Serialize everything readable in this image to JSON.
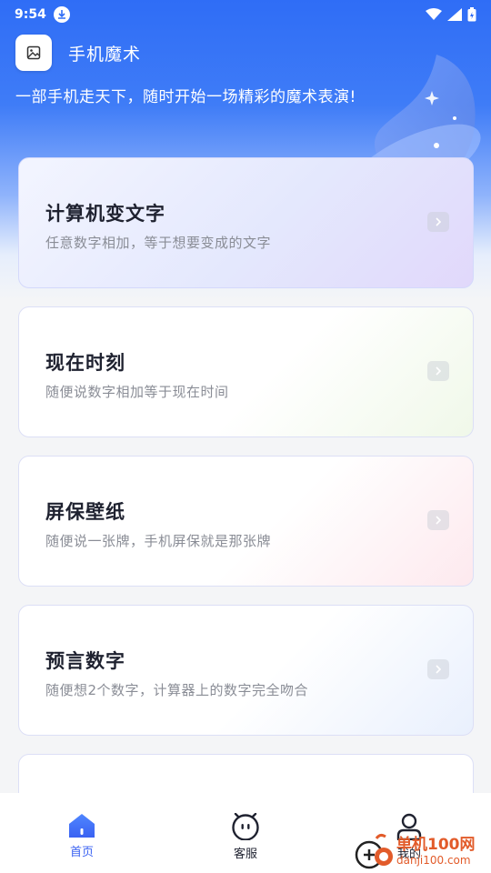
{
  "status": {
    "time": "9:54"
  },
  "app": {
    "title": "手机魔术",
    "tagline": "一部手机走天下，随时开始一场精彩的魔术表演!"
  },
  "cards": [
    {
      "title": "计算机变文字",
      "subtitle": "任意数字相加，等于想要变成的文字"
    },
    {
      "title": "现在时刻",
      "subtitle": "随便说数字相加等于现在时间"
    },
    {
      "title": "屏保壁纸",
      "subtitle": "随便说一张牌，手机屏保就是那张牌"
    },
    {
      "title": "预言数字",
      "subtitle": "随便想2个数字，计算器上的数字完全吻合"
    }
  ],
  "tabs": [
    {
      "label": "首页",
      "icon": "home-icon",
      "active": true
    },
    {
      "label": "客服",
      "icon": "customer-service-icon"
    },
    {
      "label": "我的",
      "icon": "profile-icon"
    }
  ],
  "watermark": {
    "name": "单机100网",
    "url": "danji100.com"
  },
  "colors": {
    "accent": "#3a62f2",
    "hero": "#2f6df6",
    "watermark": "#e25b2a"
  }
}
